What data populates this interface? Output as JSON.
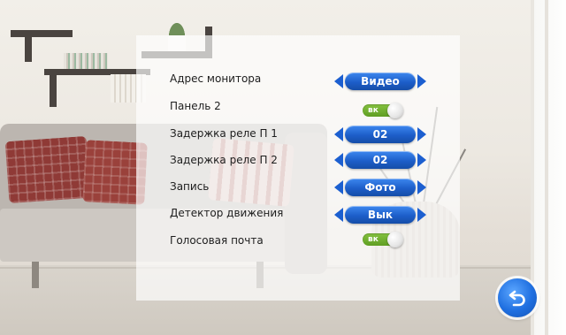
{
  "settings": {
    "rows": [
      {
        "label": "Адрес монитора",
        "control": "selector",
        "value": "Видео"
      },
      {
        "label": "Панель 2",
        "control": "toggle",
        "value": "вк"
      },
      {
        "label": "Задержка реле П 1",
        "control": "selector",
        "value": "02"
      },
      {
        "label": "Задержка реле П 2",
        "control": "selector",
        "value": "02"
      },
      {
        "label": "Запись",
        "control": "selector",
        "value": "Фото"
      },
      {
        "label": "Детектор движения",
        "control": "selector",
        "value": "Вык"
      },
      {
        "label": "Голосовая почта",
        "control": "toggle",
        "value": "вк"
      }
    ]
  },
  "colors": {
    "accent_blue": "#1d5ec9",
    "toggle_green": "#6fae2e",
    "label_text": "#1d1d1d"
  },
  "icons": {
    "back": "back-arrow-icon",
    "selector_left": "triangle-left-icon",
    "selector_right": "triangle-right-icon"
  }
}
